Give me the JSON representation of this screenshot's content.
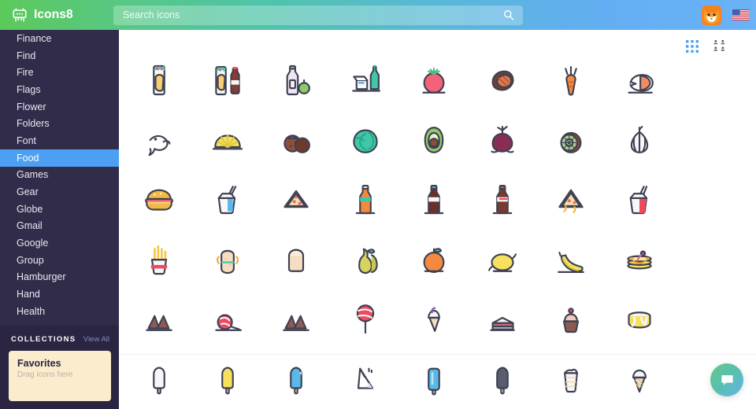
{
  "header": {
    "logo_text": "Icons8",
    "logo_icon": "robot-icon",
    "search_placeholder": "Search icons",
    "search_value": "",
    "search_icon": "search-icon",
    "avatar_icon": "fox-avatar",
    "flag_icon": "us-flag-icon"
  },
  "sidebar": {
    "items": [
      {
        "label": "Finance",
        "active": false
      },
      {
        "label": "Find",
        "active": false
      },
      {
        "label": "Fire",
        "active": false
      },
      {
        "label": "Flags",
        "active": false
      },
      {
        "label": "Flower",
        "active": false
      },
      {
        "label": "Folders",
        "active": false
      },
      {
        "label": "Font",
        "active": false
      },
      {
        "label": "Food",
        "active": true
      },
      {
        "label": "Games",
        "active": false
      },
      {
        "label": "Gear",
        "active": false
      },
      {
        "label": "Globe",
        "active": false
      },
      {
        "label": "Gmail",
        "active": false
      },
      {
        "label": "Google",
        "active": false
      },
      {
        "label": "Group",
        "active": false
      },
      {
        "label": "Hamburger",
        "active": false
      },
      {
        "label": "Hand",
        "active": false
      },
      {
        "label": "Health",
        "active": false
      }
    ],
    "collections": {
      "title": "COLLECTIONS",
      "view_all": "View All",
      "favorites_title": "Favorites",
      "favorites_sub": "Drag icons here"
    }
  },
  "content": {
    "view_toggle": {
      "grid_view": "grid-view-icon",
      "detail_view": "detail-view-icon",
      "active": "grid-view-icon"
    },
    "chat_button": "chat-bubble-icon",
    "icons": [
      {
        "name": "burrito-icon",
        "row": 0,
        "col": 0
      },
      {
        "name": "burrito-and-cola-icon",
        "row": 0,
        "col": 1
      },
      {
        "name": "milk-bottle-and-apple-icon",
        "row": 0,
        "col": 2
      },
      {
        "name": "lunchbox-and-bottle-icon",
        "row": 0,
        "col": 3
      },
      {
        "name": "tomato-icon",
        "row": 0,
        "col": 4
      },
      {
        "name": "steak-icon",
        "row": 0,
        "col": 5
      },
      {
        "name": "carrot-icon",
        "row": 0,
        "col": 6
      },
      {
        "name": "salmon-icon",
        "row": 0,
        "col": 7
      },
      {
        "name": "fish-icon",
        "row": 1,
        "col": 0
      },
      {
        "name": "lemon-slice-icon",
        "row": 1,
        "col": 1
      },
      {
        "name": "chestnuts-icon",
        "row": 1,
        "col": 2
      },
      {
        "name": "cabbage-icon",
        "row": 1,
        "col": 3
      },
      {
        "name": "avocado-icon",
        "row": 1,
        "col": 4
      },
      {
        "name": "beet-icon",
        "row": 1,
        "col": 5
      },
      {
        "name": "kiwi-icon",
        "row": 1,
        "col": 6
      },
      {
        "name": "garlic-icon",
        "row": 1,
        "col": 7
      },
      {
        "name": "hamburger-icon",
        "row": 2,
        "col": 0
      },
      {
        "name": "noodle-box-icon",
        "row": 2,
        "col": 1
      },
      {
        "name": "pizza-slice-icon",
        "row": 2,
        "col": 2
      },
      {
        "name": "orange-soda-bottle-icon",
        "row": 2,
        "col": 3
      },
      {
        "name": "cola-bottle-blue-icon",
        "row": 2,
        "col": 4
      },
      {
        "name": "cola-bottle-icon",
        "row": 2,
        "col": 5
      },
      {
        "name": "pizza-slice-cheese-icon",
        "row": 2,
        "col": 6
      },
      {
        "name": "noodle-box-red-icon",
        "row": 2,
        "col": 7
      },
      {
        "name": "french-fries-icon",
        "row": 3,
        "col": 0
      },
      {
        "name": "sandwich-icon",
        "row": 3,
        "col": 1
      },
      {
        "name": "bread-slice-icon",
        "row": 3,
        "col": 2
      },
      {
        "name": "pears-icon",
        "row": 3,
        "col": 3
      },
      {
        "name": "orange-icon",
        "row": 3,
        "col": 4
      },
      {
        "name": "lemon-icon",
        "row": 3,
        "col": 5
      },
      {
        "name": "banana-icon",
        "row": 3,
        "col": 6
      },
      {
        "name": "pancakes-icon",
        "row": 3,
        "col": 7
      },
      {
        "name": "chocolate-chips-icon",
        "row": 4,
        "col": 0
      },
      {
        "name": "lollipop-flat-icon",
        "row": 4,
        "col": 1
      },
      {
        "name": "chocolate-chips-two-icon",
        "row": 4,
        "col": 2
      },
      {
        "name": "lollipop-icon",
        "row": 4,
        "col": 3
      },
      {
        "name": "ice-cream-cone-icon",
        "row": 4,
        "col": 4
      },
      {
        "name": "cake-slice-icon",
        "row": 4,
        "col": 5
      },
      {
        "name": "cupcake-icon",
        "row": 4,
        "col": 6
      },
      {
        "name": "cheesecake-icon",
        "row": 4,
        "col": 7
      },
      {
        "name": "popsicle-white-icon",
        "row": 5,
        "col": 0
      },
      {
        "name": "popsicle-yellow-icon",
        "row": 5,
        "col": 1
      },
      {
        "name": "popsicle-blue-icon",
        "row": 5,
        "col": 2
      },
      {
        "name": "cone-outline-icon",
        "row": 5,
        "col": 3
      },
      {
        "name": "ice-pop-blue-icon",
        "row": 5,
        "col": 4
      },
      {
        "name": "popsicle-dark-icon",
        "row": 5,
        "col": 5
      },
      {
        "name": "milkshake-cup-icon",
        "row": 5,
        "col": 6
      },
      {
        "name": "ice-cream-waffle-cone-icon",
        "row": 5,
        "col": 7
      }
    ]
  },
  "colors": {
    "header_green": "#5cc95c",
    "header_blue": "#6bb2f7",
    "sidebar_bg": "#322c4b",
    "sidebar_active": "#4c9ff2",
    "collections_bg": "#2b2542",
    "favorites_card": "#fbeccd",
    "icon_stroke": "#3e4152"
  }
}
